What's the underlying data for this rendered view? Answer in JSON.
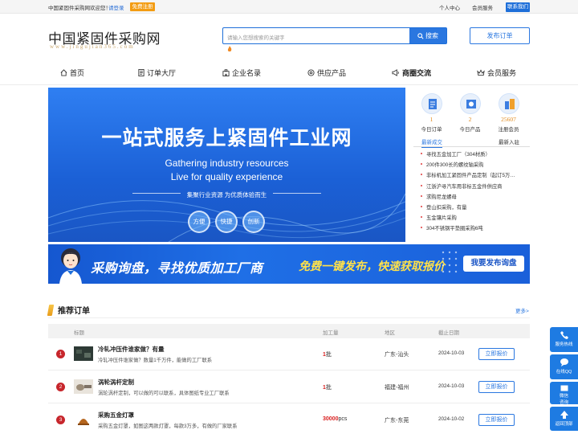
{
  "topbar": {
    "welcome": "中国紧固件采购网欢迎您！",
    "login": "请登录",
    "register": "免费注册",
    "user_center": "个人中心",
    "member_service": "会员服务",
    "contact": "联系我们"
  },
  "header": {
    "logo": "中国紧固件采购网",
    "logo_sub": "www.jingujian365.com",
    "search_placeholder": "请输入您想搜索的关键字",
    "search_button": "搜索",
    "publish_button": "发布订单"
  },
  "nav": {
    "items": [
      {
        "label": "首页",
        "icon": "home-icon"
      },
      {
        "label": "订单大厅",
        "icon": "document-icon"
      },
      {
        "label": "企业名录",
        "icon": "building-icon"
      },
      {
        "label": "供应产品",
        "icon": "settings-icon"
      },
      {
        "label": "商圈交流",
        "icon": "megaphone-icon"
      },
      {
        "label": "会员服务",
        "icon": "crown-icon"
      }
    ]
  },
  "banner": {
    "title": "一站式服务上紧固件工业网",
    "en_line1": "Gathering industry resources",
    "en_line2": "Live for quality experience",
    "subtitle": "集聚行业资源 为优质体验而生",
    "badges": [
      "方便",
      "快捷",
      "创新"
    ]
  },
  "stats": [
    {
      "value": "1",
      "label": "今日订单",
      "icon": "order-icon"
    },
    {
      "value": "2",
      "label": "今日产品",
      "icon": "product-icon"
    },
    {
      "value": "25607",
      "label": "注册会员",
      "icon": "member-icon"
    }
  ],
  "news": {
    "tab_active": "最新成交",
    "tab_other": "最新入驻",
    "items": [
      "寻找五金加工厂（304材质）",
      "200件300长的螺纹轴采购",
      "非标机加工紧固件产品定制（起订5万…",
      "江浙沪寻汽车用非标五金件供应商",
      "求购尼龙螺母",
      "登山扣采购，有量",
      "五金镶片采购",
      "304不锈钢平垫圈采购6吨"
    ]
  },
  "ad": {
    "text1": "采购询盘，寻找优质加工厂商",
    "text2": "免费一键发布，快速获取报价",
    "button": "我要发布询盘"
  },
  "section": {
    "title": "推荐订单",
    "more": "更多>",
    "columns": [
      "标题",
      "加工量",
      "地区",
      "截止日期"
    ]
  },
  "orders": [
    {
      "index": "1",
      "title": "冷轧冲压件谁家做？有量",
      "desc": "冷轧冲压件谁家做？数量1千万件，能做的工厂联系",
      "qty": "1",
      "unit": "批",
      "area": "广东-汕头",
      "date": "2024-10-03",
      "button": "立即报价"
    },
    {
      "index": "2",
      "title": "涡轮涡杆定制",
      "desc": "涡轮涡杆定制，可以做的可以联系，具体图纸专业工厂联系",
      "qty": "1",
      "unit": "批",
      "area": "福建-福州",
      "date": "2024-10-03",
      "button": "立即报价"
    },
    {
      "index": "3",
      "title": "采购五金灯罩",
      "desc": "采购五金灯罩，如图这两款灯罩，每款3万多，有做的厂家联系",
      "qty": "30000",
      "unit": "pcs",
      "area": "广东-东莞",
      "date": "2024-10-02",
      "button": "立即报价"
    }
  ],
  "float_bar": {
    "hotline": "服务热线",
    "qq": "在线QQ",
    "wechat_1": "微信",
    "wechat_2": "咨询",
    "top": "返回顶部"
  },
  "colors": {
    "primary": "#2a77e0",
    "accent_orange": "#f39c12",
    "price_red": "#d91f1f",
    "index_red": "#c7262c"
  }
}
